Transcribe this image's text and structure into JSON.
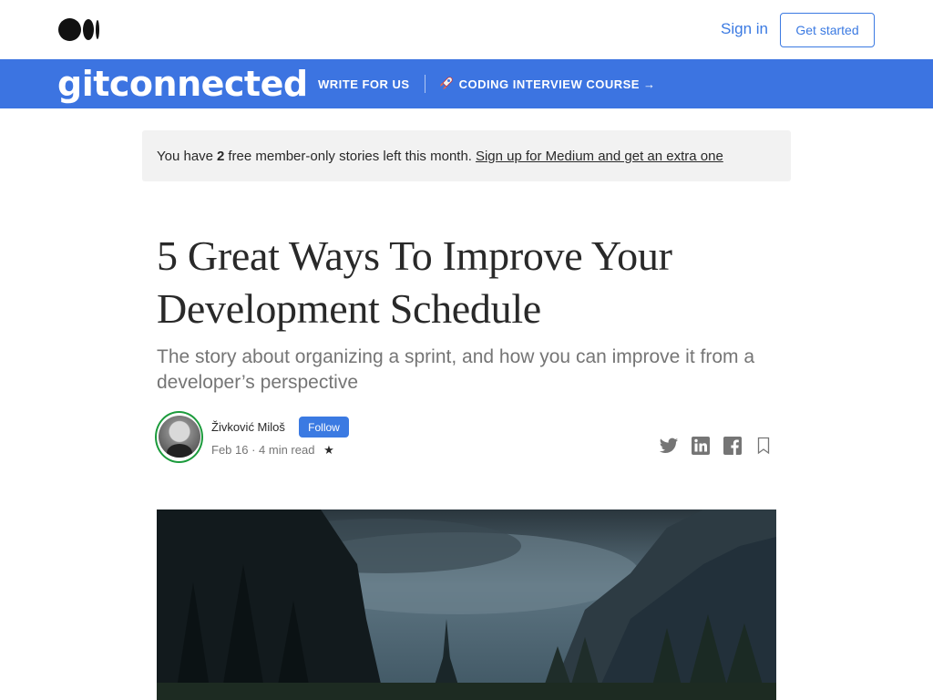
{
  "header": {
    "sign_in": "Sign in",
    "get_started": "Get started"
  },
  "publication": {
    "name": "gitconnected",
    "nav": {
      "write_for_us": "WRITE FOR US",
      "course": "CODING INTERVIEW COURSE →"
    },
    "bar_color": "#3c74e1"
  },
  "banner": {
    "prefix": "You have",
    "count": "2",
    "suffix": "free member-only stories left this month.",
    "link": "Sign up for Medium and get an extra one"
  },
  "article": {
    "title": "5 Great Ways To Improve Your Development Schedule",
    "subtitle": "The story about organizing a sprint, and how you can improve it from a developer’s perspective",
    "author": "Živković Miloš",
    "follow": "Follow",
    "meta": "Feb 16 · 4 min read",
    "star": "★"
  },
  "icons": [
    "medium-logo-icon",
    "rocket-icon",
    "twitter-icon",
    "linkedin-icon",
    "facebook-icon",
    "bookmark-icon"
  ],
  "colors": {
    "accent": "#3b7ae2",
    "banner_bg": "#f2f2f2",
    "avatar_ring": "#1c9b3c"
  }
}
